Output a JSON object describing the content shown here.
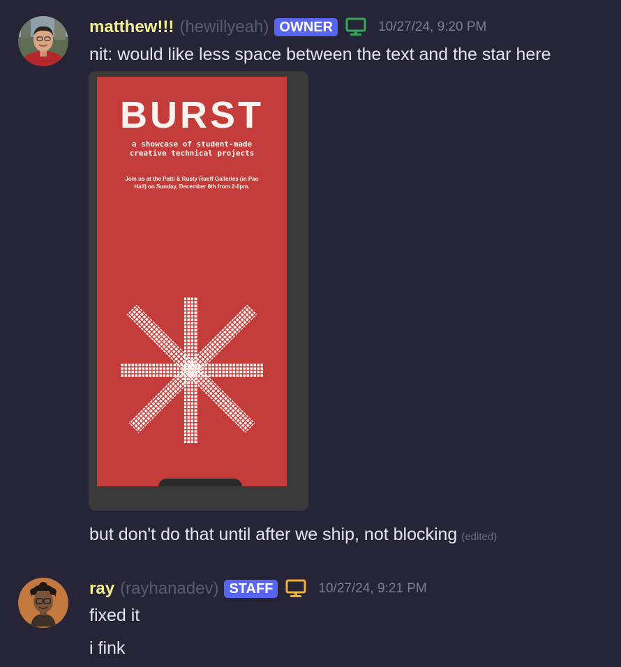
{
  "messages": [
    {
      "username": "matthew!!!",
      "handle": "(hewillyeah)",
      "role": "OWNER",
      "device_icon": "desktop-icon",
      "device_color": "#3ba55c",
      "timestamp": "10/27/24, 9:20 PM",
      "lines": [
        "nit: would like less space between the text and the star here"
      ],
      "attachment": {
        "poster_title": "BURST",
        "poster_subtitle_1": "a showcase of student-made",
        "poster_subtitle_2": "creative technical projects",
        "poster_info_1": "Join us at the Patti & Rusty Rueff Galleries (in Pao",
        "poster_info_2": "Hall) on Sunday, December 8th from 2-6pm."
      },
      "followup": "but don't do that until after we ship, not blocking",
      "edited_label": "(edited)"
    },
    {
      "username": "ray",
      "handle": "(rayhanadev)",
      "role": "STAFF",
      "device_icon": "desktop-icon",
      "device_color": "#f0b232",
      "timestamp": "10/27/24, 9:21 PM",
      "lines": [
        "fixed it",
        "i fink"
      ]
    }
  ],
  "colors": {
    "background": "#262538",
    "username": "#f3ef92",
    "role_badge": "#5865f2",
    "poster_red": "#c43c3a"
  }
}
